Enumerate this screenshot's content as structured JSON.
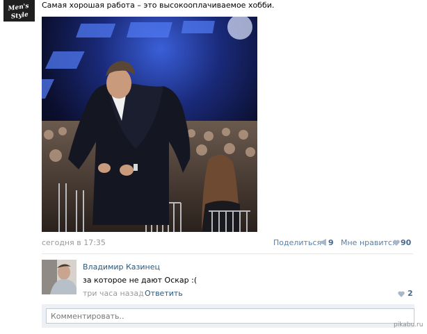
{
  "post": {
    "author_avatar_text": "Men's Style",
    "text": "Самая хорошая работа – это высокооплачиваемое хобби.",
    "date": "сегодня в 17:35",
    "share_label": "Поделиться",
    "share_count": "9",
    "like_label": "Мне нравится",
    "like_count": "90"
  },
  "comment": {
    "author": "Владимир Казинец",
    "text": "за которое не дают Оскар :(",
    "time": "три часа назад",
    "separator": "|",
    "reply_label": "Ответить",
    "like_count": "2"
  },
  "reply_box": {
    "placeholder": "Комментировать.."
  },
  "watermark": "pikabu.ru",
  "colors": {
    "link": "#2b587a",
    "meta": "#999999",
    "count": "#45688e",
    "reply_bg": "#edf1f5"
  },
  "icons": {
    "share": "megaphone-icon",
    "like": "heart-icon"
  }
}
